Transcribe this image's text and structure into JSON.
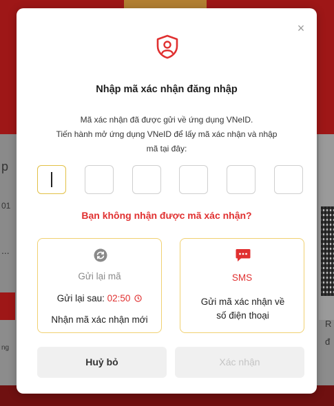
{
  "background": {
    "left_texts": [
      "p",
      "01",
      "..."
    ],
    "bottom_left_text": "ng",
    "right_texts": [
      "R",
      "đ"
    ]
  },
  "modal": {
    "close_glyph": "×",
    "icon": "shield-user-icon",
    "title": "Nhập mã xác nhận đăng nhập",
    "desc_line1": "Mã xác nhận đã được gửi về ứng dụng VNeID.",
    "desc_line2": "Tiến hành mở ứng dụng VNeID để lấy mã xác nhận và nhập",
    "desc_line3": "mã tại đây:",
    "otp_count": 6,
    "otp_values": [
      "",
      "",
      "",
      "",
      "",
      ""
    ],
    "no_code_text": "Bạn không nhận được mã xác nhận?",
    "resend_card": {
      "icon": "refresh-icon",
      "title": "Gửi lại mã",
      "after_label": "Gửi lại sau:",
      "timer": "02:50",
      "timer_icon": "clock-icon",
      "new_code_text": "Nhận mã xác nhận mới"
    },
    "sms_card": {
      "icon": "sms-icon",
      "title": "SMS",
      "desc_line1": "Gửi mã xác nhận về",
      "desc_line2": "số điện thoại"
    },
    "cancel_label": "Huỷ bỏ",
    "confirm_label": "Xác nhận"
  },
  "colors": {
    "accent_red": "#e03030",
    "card_border": "#f0d070",
    "otp_active_border": "#e2c045"
  }
}
